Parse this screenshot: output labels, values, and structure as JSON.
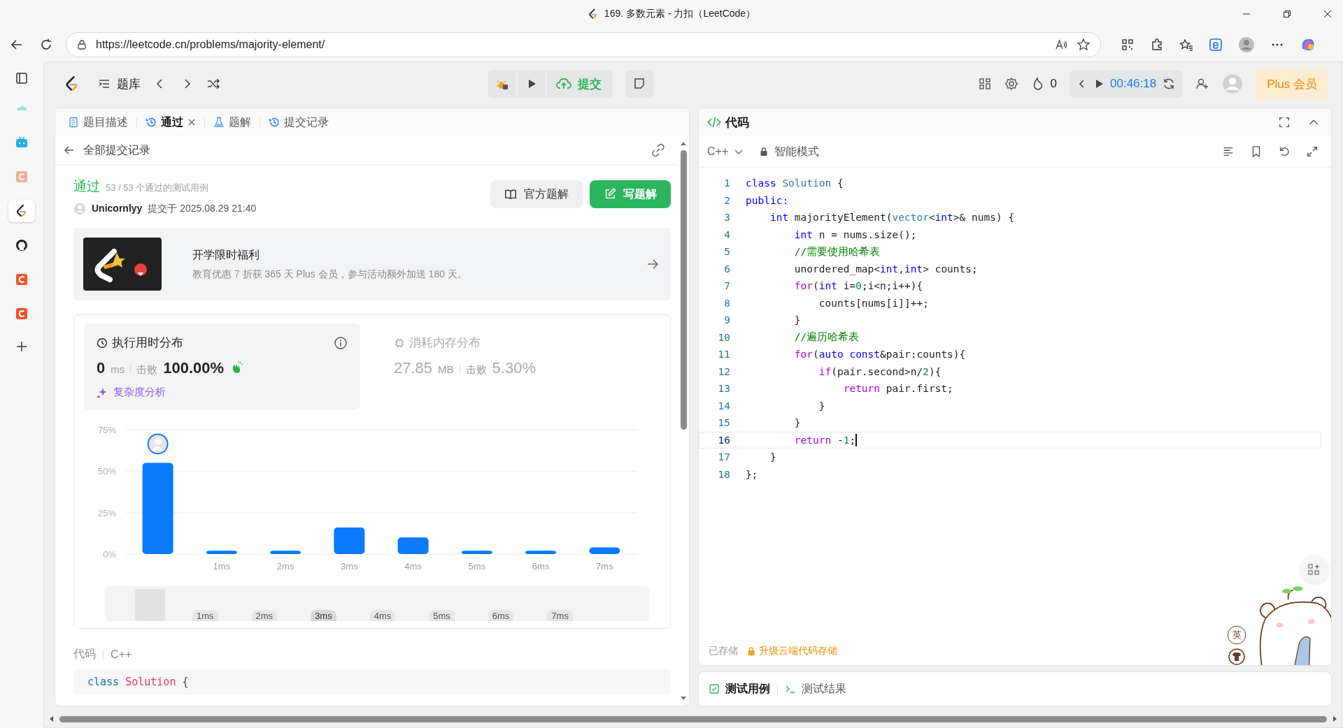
{
  "window": {
    "title": "169. 多数元素 - 力扣（LeetCode）"
  },
  "browser": {
    "url": "https://leetcode.cn/problems/majority-element/"
  },
  "browser_sidebar": [
    {
      "kind": "cloud",
      "selected": false,
      "dimmed": true
    },
    {
      "kind": "tv",
      "selected": false,
      "dimmed": false
    },
    {
      "kind": "c",
      "selected": false,
      "dimmed": true
    },
    {
      "kind": "leetcode",
      "selected": true,
      "dimmed": false
    },
    {
      "kind": "github",
      "selected": false,
      "dimmed": false
    },
    {
      "kind": "c",
      "selected": false,
      "dimmed": false
    },
    {
      "kind": "c",
      "selected": false,
      "dimmed": false
    }
  ],
  "nav": {
    "problems_label": "题库",
    "submit_label": "提交",
    "streak": "0",
    "timer": "00:46:18",
    "plus_label": "Plus 会员"
  },
  "left_tabs": [
    {
      "label": "题目描述",
      "kind": "description",
      "selected": false,
      "closable": false
    },
    {
      "label": "通过",
      "kind": "accepted",
      "selected": true,
      "closable": true
    },
    {
      "label": "题解",
      "kind": "solutions",
      "selected": false,
      "closable": false
    },
    {
      "label": "提交记录",
      "kind": "submissions",
      "selected": false,
      "closable": false
    }
  ],
  "submission": {
    "back_label": "全部提交记录",
    "status": "通过",
    "cases": "53 / 53 个通过的测试用例",
    "user": "Unicornlyy",
    "submitted": "提交于 2025.08.29 21:40",
    "buttons": [
      {
        "label": "官方题解",
        "kind": "secondary"
      },
      {
        "label": "写题解",
        "kind": "primary"
      }
    ]
  },
  "promo": {
    "title": "开学限时福利",
    "text": "教育优惠 7 折获 365 天 Plus 会员，参与活动额外加送 180 天。"
  },
  "distribution": {
    "stats": [
      {
        "kind": "time",
        "title": "执行用时分布",
        "value": "0",
        "unit": "ms",
        "beat_label": "击败",
        "beat": "100.00%",
        "selected": true,
        "link": "复杂度分析"
      },
      {
        "kind": "memory",
        "title": "消耗内存分布",
        "value": "27.85",
        "unit": "MB",
        "beat_label": "击败",
        "beat": "5.30%",
        "selected": false
      }
    ],
    "chart_data": {
      "type": "bar",
      "categories": [
        null,
        "1ms",
        "2ms",
        "3ms",
        "4ms",
        "5ms",
        "6ms",
        "7ms"
      ],
      "values": [
        55,
        2,
        2,
        16,
        10,
        2,
        2,
        4
      ],
      "ylim": [
        0,
        75
      ],
      "yticks": [
        {
          "value": 0,
          "label": "0%"
        },
        {
          "value": 25,
          "label": "25%"
        },
        {
          "value": 50,
          "label": "50%"
        },
        {
          "value": 75,
          "label": "75%"
        }
      ]
    },
    "range_labels": [
      {
        "text": "1ms",
        "selected": false
      },
      {
        "text": "2ms",
        "selected": false
      },
      {
        "text": "3ms",
        "selected": true
      },
      {
        "text": "4ms",
        "selected": false
      },
      {
        "text": "5ms",
        "selected": false
      },
      {
        "text": "6ms",
        "selected": false
      },
      {
        "text": "7ms",
        "selected": false
      }
    ]
  },
  "code_preview": {
    "label": "代码",
    "language": "C++",
    "tokens": [
      {
        "text": "class",
        "kind": "keyword"
      },
      {
        "text": " Solution",
        "kind": "name"
      },
      {
        "text": " {",
        "kind": "plain"
      }
    ]
  },
  "editor": {
    "title": "代码",
    "language": "C++",
    "mode": "智能模式",
    "saved": "已存储",
    "upgrade": "升级云端代码存储",
    "lines": [
      {
        "number": "1",
        "current": false,
        "tokens": [
          {
            "text": "class",
            "kind": "keyword"
          },
          {
            "text": " Solution",
            "kind": "type"
          },
          {
            "text": " {",
            "kind": "plain"
          }
        ]
      },
      {
        "number": "2",
        "current": false,
        "tokens": [
          {
            "text": "public:",
            "kind": "keyword"
          }
        ]
      },
      {
        "number": "3",
        "current": false,
        "tokens": [
          {
            "text": "    int",
            "kind": "keyword"
          },
          {
            "text": " majorityElement(",
            "kind": "plain"
          },
          {
            "text": "vector",
            "kind": "type"
          },
          {
            "text": "<",
            "kind": "plain"
          },
          {
            "text": "int",
            "kind": "keyword"
          },
          {
            "text": ">& nums) {",
            "kind": "plain"
          }
        ]
      },
      {
        "number": "4",
        "current": false,
        "tokens": [
          {
            "text": "        int",
            "kind": "keyword"
          },
          {
            "text": " n = nums.size();",
            "kind": "plain"
          }
        ]
      },
      {
        "number": "5",
        "current": false,
        "tokens": [
          {
            "text": "        //需要使用哈希表",
            "kind": "comment"
          }
        ]
      },
      {
        "number": "6",
        "current": false,
        "tokens": [
          {
            "text": "        unordered_map<",
            "kind": "plain"
          },
          {
            "text": "int",
            "kind": "keyword"
          },
          {
            "text": ",",
            "kind": "plain"
          },
          {
            "text": "int",
            "kind": "keyword"
          },
          {
            "text": "> counts;",
            "kind": "plain"
          }
        ]
      },
      {
        "number": "7",
        "current": false,
        "tokens": [
          {
            "text": "        for",
            "kind": "control"
          },
          {
            "text": "(",
            "kind": "plain"
          },
          {
            "text": "int",
            "kind": "keyword"
          },
          {
            "text": " i=",
            "kind": "plain"
          },
          {
            "text": "0",
            "kind": "number"
          },
          {
            "text": ";i<n;i++){",
            "kind": "plain"
          }
        ]
      },
      {
        "number": "8",
        "current": false,
        "tokens": [
          {
            "text": "            counts[nums[i]]++;",
            "kind": "plain"
          }
        ]
      },
      {
        "number": "9",
        "current": false,
        "tokens": [
          {
            "text": "        }",
            "kind": "plain"
          }
        ]
      },
      {
        "number": "10",
        "current": false,
        "tokens": [
          {
            "text": "        //遍历哈希表",
            "kind": "comment"
          }
        ]
      },
      {
        "number": "11",
        "current": false,
        "tokens": [
          {
            "text": "        for",
            "kind": "control"
          },
          {
            "text": "(",
            "kind": "plain"
          },
          {
            "text": "auto const",
            "kind": "keyword"
          },
          {
            "text": "&pair:counts){",
            "kind": "plain"
          }
        ]
      },
      {
        "number": "12",
        "current": false,
        "tokens": [
          {
            "text": "            if",
            "kind": "control"
          },
          {
            "text": "(pair.second>n/",
            "kind": "plain"
          },
          {
            "text": "2",
            "kind": "number"
          },
          {
            "text": "){",
            "kind": "plain"
          }
        ]
      },
      {
        "number": "13",
        "current": false,
        "tokens": [
          {
            "text": "                return",
            "kind": "control"
          },
          {
            "text": " pair.first;",
            "kind": "plain"
          }
        ]
      },
      {
        "number": "14",
        "current": false,
        "tokens": [
          {
            "text": "            }",
            "kind": "plain"
          }
        ]
      },
      {
        "number": "15",
        "current": false,
        "tokens": [
          {
            "text": "        }",
            "kind": "plain"
          }
        ]
      },
      {
        "number": "16",
        "current": true,
        "tokens": [
          {
            "text": "        return",
            "kind": "control"
          },
          {
            "text": " -",
            "kind": "plain"
          },
          {
            "text": "1",
            "kind": "number"
          },
          {
            "text": ";",
            "kind": "plain"
          }
        ]
      },
      {
        "number": "17",
        "current": false,
        "tokens": [
          {
            "text": "    }",
            "kind": "plain"
          }
        ]
      },
      {
        "number": "18",
        "current": false,
        "tokens": [
          {
            "text": "};",
            "kind": "plain"
          }
        ]
      }
    ]
  },
  "bottom_tabs": [
    {
      "label": "测试用例",
      "kind": "testcase",
      "selected": true
    },
    {
      "label": "测试结果",
      "kind": "result",
      "selected": false
    }
  ],
  "ime": {
    "label": "英"
  }
}
